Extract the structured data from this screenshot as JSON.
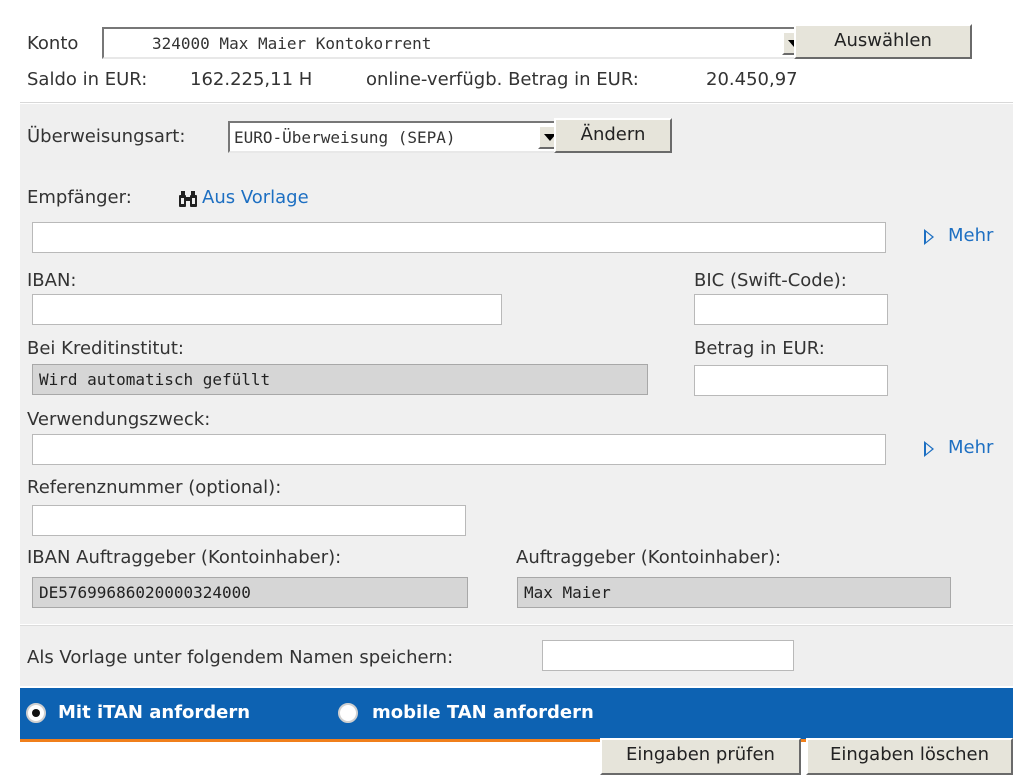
{
  "account": {
    "label": "Konto",
    "selected": "324000  Max Maier  Kontokorrent",
    "select_button": "Auswählen",
    "balance_label": "Saldo in EUR:",
    "balance_value": "162.225,11 H",
    "available_label": "online-verfügb. Betrag in EUR:",
    "available_value": "20.450,97"
  },
  "transfer_type": {
    "label": "Überweisungsart:",
    "selected": "EURO-Überweisung (SEPA)",
    "change_button": "Ändern"
  },
  "form": {
    "recipient_label": "Empfänger:",
    "template_link": "Aus Vorlage",
    "recipient_value": "",
    "more_link": "Mehr",
    "iban_label": "IBAN:",
    "iban_value": "",
    "bic_label": "BIC (Swift-Code):",
    "bic_value": "",
    "bank_label": "Bei Kreditinstitut:",
    "bank_value": "Wird automatisch gefüllt",
    "amount_label": "Betrag in EUR:",
    "amount_value": "",
    "purpose_label": "Verwendungszweck:",
    "purpose_value": "",
    "purpose_more_link": "Mehr",
    "reference_label": "Referenznummer (optional):",
    "reference_value": "",
    "payer_iban_label": "IBAN Auftraggeber (Kontoinhaber):",
    "payer_iban_value": "DE57699686020000324000",
    "payer_name_label": "Auftraggeber (Kontoinhaber):",
    "payer_name_value": "Max Maier"
  },
  "template_save": {
    "label": "Als Vorlage unter folgendem Namen speichern:",
    "value": ""
  },
  "tan": {
    "option_itan": "Mit iTAN anfordern",
    "option_mobile": "mobile TAN anfordern",
    "itan_selected": true
  },
  "actions": {
    "check_button": "Eingaben prüfen",
    "clear_button": "Eingaben löschen"
  },
  "colors": {
    "tan_bar": "#0d62b2",
    "accent_line": "#f07f1b",
    "link": "#1d6fc2"
  }
}
